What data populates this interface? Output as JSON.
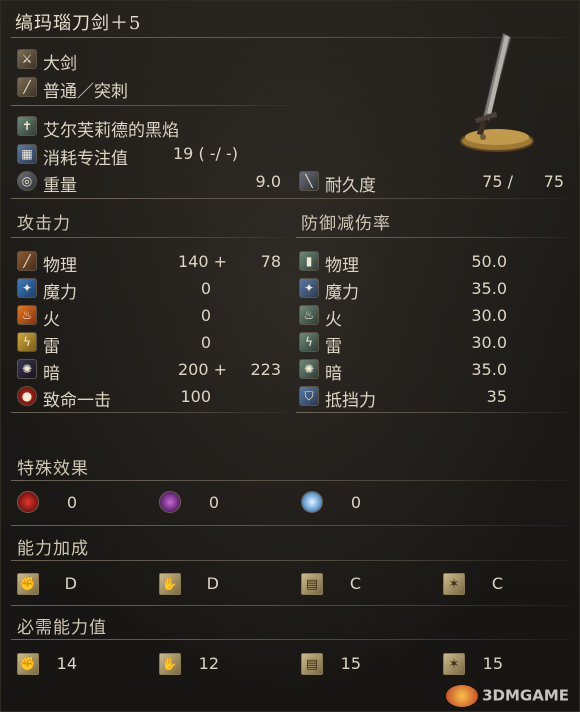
{
  "weapon": {
    "name": "缟玛瑙刀剑＋5",
    "type": "大剑",
    "attack_type": "普通／突刺",
    "skill": "艾尔芙莉德的黑焰",
    "fp_label": "消耗专注值",
    "fp_value": "19 (   -/   -)",
    "weight_label": "重量",
    "weight_value": "9.0",
    "durability_label": "耐久度",
    "durability_current": "75 /",
    "durability_max": "75"
  },
  "attack": {
    "heading": "攻击力",
    "rows": [
      {
        "label": "物理",
        "base": "140 +",
        "bonus": "78"
      },
      {
        "label": "魔力",
        "base": "0",
        "bonus": ""
      },
      {
        "label": "火",
        "base": "0",
        "bonus": ""
      },
      {
        "label": "雷",
        "base": "0",
        "bonus": ""
      },
      {
        "label": "暗",
        "base": "200 +",
        "bonus": "223"
      },
      {
        "label": "致命一击",
        "base": "100",
        "bonus": ""
      }
    ]
  },
  "defense": {
    "heading": "防御减伤率",
    "rows": [
      {
        "label": "物理",
        "value": "50.0"
      },
      {
        "label": "魔力",
        "value": "35.0"
      },
      {
        "label": "火",
        "value": "30.0"
      },
      {
        "label": "雷",
        "value": "30.0"
      },
      {
        "label": "暗",
        "value": "35.0"
      },
      {
        "label": "抵挡力",
        "value": "35"
      }
    ]
  },
  "special": {
    "heading": "特殊效果",
    "bleed": "0",
    "poison": "0",
    "frost": "0"
  },
  "scaling": {
    "heading": "能力加成",
    "str": "D",
    "dex": "D",
    "int": "C",
    "fai": "C"
  },
  "requirements": {
    "heading": "必需能力值",
    "str": "14",
    "dex": "12",
    "int": "15",
    "fai": "15"
  },
  "watermark": "3DMGAME",
  "icons": {
    "weapon_type": "sword-type-icon",
    "attack_type": "slash-icon",
    "skill": "skill-icon",
    "fp": "fp-icon",
    "weight": "weight-icon",
    "durability": "durability-icon"
  },
  "colors": {
    "background": "#1c1a17",
    "text": "#ddd5c3",
    "rule": "#968c78"
  }
}
